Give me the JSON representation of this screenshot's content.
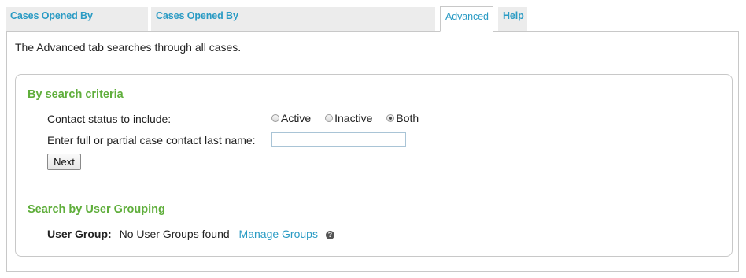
{
  "tabs": [
    {
      "label": "Cases Opened By",
      "active": false
    },
    {
      "label": "Cases Opened By",
      "active": false
    },
    {
      "label": "Advanced",
      "active": true
    },
    {
      "label": "Help",
      "active": false
    }
  ],
  "intro_text": "The Advanced tab searches through all cases.",
  "criteria": {
    "title": "By search criteria",
    "status_label": "Contact status to include:",
    "status_options": [
      "Active",
      "Inactive",
      "Both"
    ],
    "status_selected": "Both",
    "lastname_label": "Enter full or partial case contact last name:",
    "lastname_value": "",
    "next_label": "Next"
  },
  "grouping": {
    "title": "Search by User Grouping",
    "label": "User Group:",
    "value": "No User Groups found",
    "manage_link": "Manage Groups",
    "help_icon": "question-circle-icon"
  },
  "colors": {
    "accent_green": "#5fae3b",
    "link_blue": "#2a9bc4"
  }
}
